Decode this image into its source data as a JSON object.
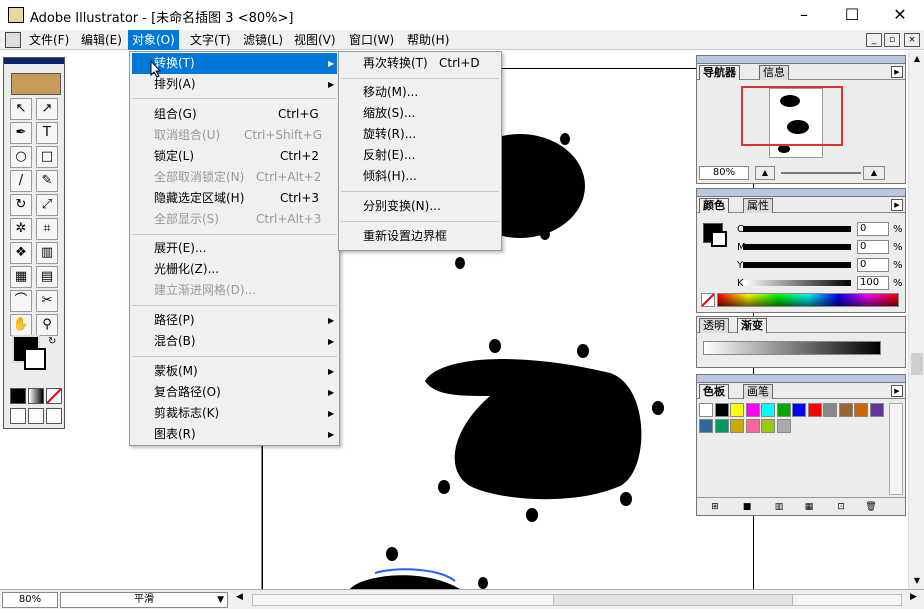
{
  "window": {
    "title": "Adobe Illustrator - [未命名插图 3 <80%>]",
    "minimize": "–",
    "maximize": "☐",
    "close": "✕"
  },
  "menubar": {
    "items": [
      "文件(F)",
      "编辑(E)",
      "对象(O)",
      "文字(T)",
      "滤镜(L)",
      "视图(V)",
      "窗口(W)",
      "帮助(H)"
    ],
    "active_index": 2,
    "mdi_min": "_",
    "mdi_restore": "▫",
    "mdi_close": "×"
  },
  "object_menu": {
    "items": [
      {
        "label": "转换(T)",
        "shortcut": "",
        "submenu": true,
        "highlighted": true,
        "disabled": false
      },
      {
        "label": "排列(A)",
        "shortcut": "",
        "submenu": true,
        "disabled": false
      },
      {
        "label": "组合(G)",
        "shortcut": "Ctrl+G",
        "disabled": false
      },
      {
        "label": "取消组合(U)",
        "shortcut": "Ctrl+Shift+G",
        "disabled": true
      },
      {
        "label": "锁定(L)",
        "shortcut": "Ctrl+2",
        "disabled": false
      },
      {
        "label": "全部取消锁定(N)",
        "shortcut": "Ctrl+Alt+2",
        "disabled": true
      },
      {
        "label": "隐藏选定区域(H)",
        "shortcut": "Ctrl+3",
        "disabled": false
      },
      {
        "label": "全部显示(S)",
        "shortcut": "Ctrl+Alt+3",
        "disabled": true
      },
      {
        "label": "展开(E)...",
        "shortcut": "",
        "disabled": false
      },
      {
        "label": "光栅化(Z)...",
        "shortcut": "",
        "disabled": false
      },
      {
        "label": "建立渐进网格(D)...",
        "shortcut": "",
        "disabled": true
      },
      {
        "label": "路径(P)",
        "shortcut": "",
        "submenu": true,
        "disabled": false
      },
      {
        "label": "混合(B)",
        "shortcut": "",
        "submenu": true,
        "disabled": false
      },
      {
        "label": "蒙板(M)",
        "shortcut": "",
        "submenu": true,
        "disabled": false
      },
      {
        "label": "复合路径(O)",
        "shortcut": "",
        "submenu": true,
        "disabled": false
      },
      {
        "label": "剪裁标志(K)",
        "shortcut": "",
        "submenu": true,
        "disabled": false
      },
      {
        "label": "图表(R)",
        "shortcut": "",
        "submenu": true,
        "disabled": false
      }
    ]
  },
  "transform_submenu": {
    "items": [
      {
        "label": "再次转换(T)",
        "shortcut": "Ctrl+D"
      },
      {
        "label": "移动(M)...",
        "shortcut": ""
      },
      {
        "label": "缩放(S)...",
        "shortcut": ""
      },
      {
        "label": "旋转(R)...",
        "shortcut": ""
      },
      {
        "label": "反射(E)...",
        "shortcut": ""
      },
      {
        "label": "倾斜(H)...",
        "shortcut": ""
      },
      {
        "label": "分别变换(N)...",
        "shortcut": ""
      },
      {
        "label": "重新设置边界框",
        "shortcut": ""
      }
    ]
  },
  "navigator_panel": {
    "tabs": [
      "导航器",
      "信息"
    ],
    "zoom": "80%"
  },
  "color_panel": {
    "tabs": [
      "颜色",
      "属性"
    ],
    "channels": [
      {
        "label": "C",
        "value": "0"
      },
      {
        "label": "M",
        "value": "0"
      },
      {
        "label": "Y",
        "value": "0"
      },
      {
        "label": "K",
        "value": "100"
      }
    ],
    "percent": "%"
  },
  "gradient_panel": {
    "tabs": [
      "透明",
      "渐变"
    ]
  },
  "swatches_panel": {
    "tabs": [
      "色板",
      "画笔"
    ],
    "colors": [
      "#ffffff",
      "#000000",
      "#ffff00",
      "#ff00ff",
      "#00ffff",
      "#00aa00",
      "#0000ff",
      "#ff0000",
      "#888888",
      "#996633",
      "#cc6600",
      "#663399",
      "#336699",
      "#009966",
      "#ccaa00",
      "#ff6699",
      "#99cc00",
      "#aaaaaa"
    ]
  },
  "statusbar": {
    "zoom": "80%",
    "mode": "平滑"
  }
}
